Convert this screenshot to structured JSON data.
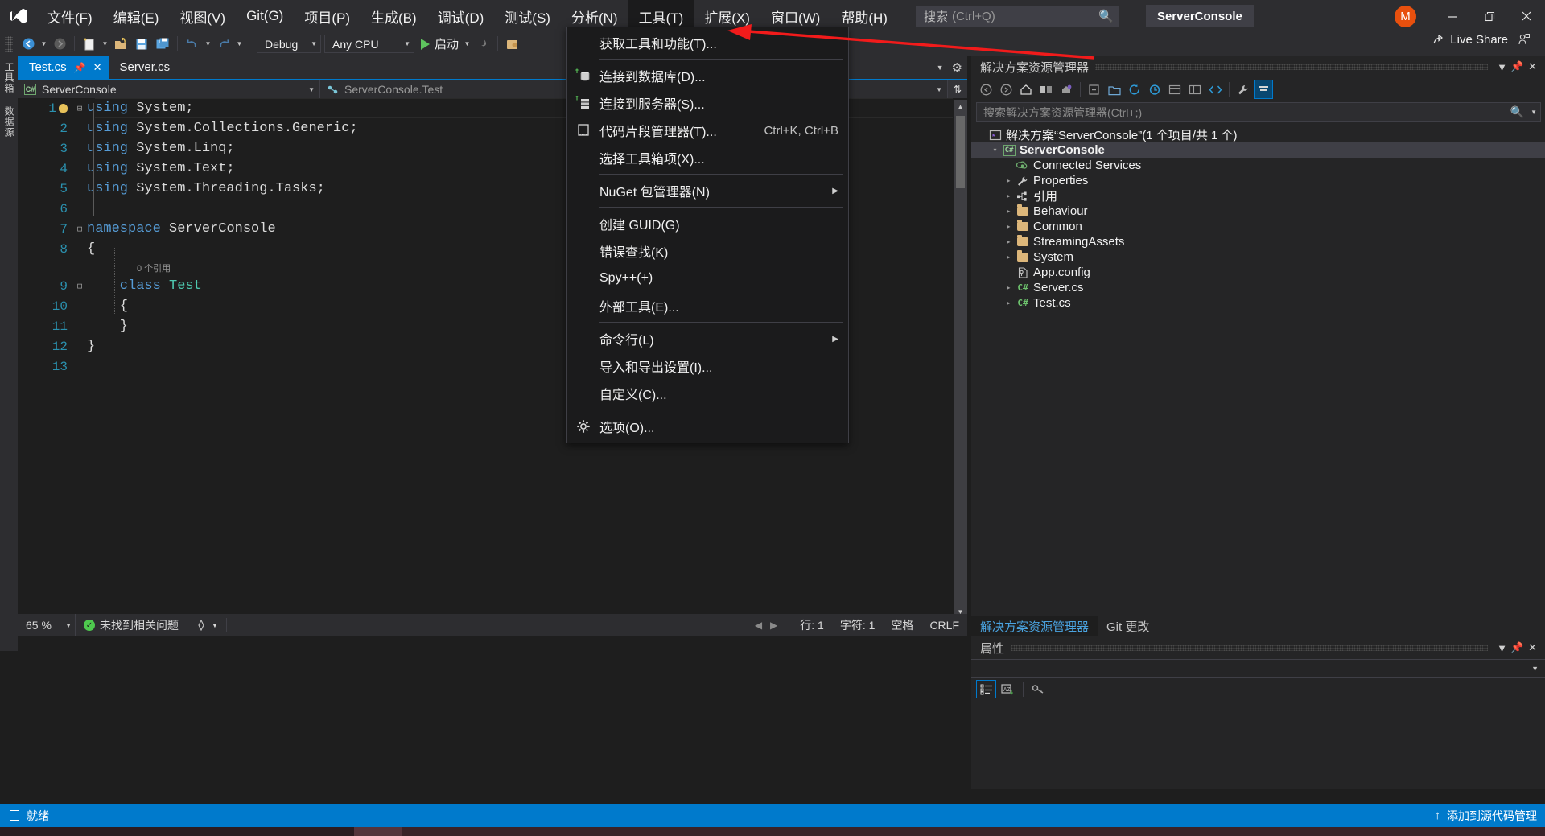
{
  "window": {
    "project_chip": "ServerConsole",
    "avatar_initial": "M",
    "live_share": "Live Share"
  },
  "menubar": {
    "items": [
      {
        "label": "文件(F)",
        "active": false
      },
      {
        "label": "编辑(E)",
        "active": false
      },
      {
        "label": "视图(V)",
        "active": false
      },
      {
        "label": "Git(G)",
        "active": false
      },
      {
        "label": "项目(P)",
        "active": false
      },
      {
        "label": "生成(B)",
        "active": false
      },
      {
        "label": "调试(D)",
        "active": false
      },
      {
        "label": "测试(S)",
        "active": false
      },
      {
        "label": "分析(N)",
        "active": false
      },
      {
        "label": "工具(T)",
        "active": true
      },
      {
        "label": "扩展(X)",
        "active": false
      },
      {
        "label": "窗口(W)",
        "active": false
      },
      {
        "label": "帮助(H)",
        "active": false
      }
    ]
  },
  "search": {
    "label": "搜索",
    "shortcut": "(Ctrl+Q)"
  },
  "toolbar": {
    "config": "Debug",
    "platform": "Any CPU",
    "run_label": "启动"
  },
  "tools_menu": {
    "items": [
      {
        "label": "获取工具和功能(T)...",
        "icon": "",
        "shortcut": "",
        "submenu": false,
        "sep_after": true
      },
      {
        "label": "连接到数据库(D)...",
        "icon": "database-icon",
        "shortcut": "",
        "submenu": false,
        "sep_after": false
      },
      {
        "label": "连接到服务器(S)...",
        "icon": "server-icon",
        "shortcut": "",
        "submenu": false,
        "sep_after": false
      },
      {
        "label": "代码片段管理器(T)...",
        "icon": "snippet-icon",
        "shortcut": "Ctrl+K, Ctrl+B",
        "submenu": false,
        "sep_after": false
      },
      {
        "label": "选择工具箱项(X)...",
        "icon": "",
        "shortcut": "",
        "submenu": false,
        "sep_after": true
      },
      {
        "label": "NuGet 包管理器(N)",
        "icon": "",
        "shortcut": "",
        "submenu": true,
        "sep_after": true
      },
      {
        "label": "创建 GUID(G)",
        "icon": "",
        "shortcut": "",
        "submenu": false,
        "sep_after": false
      },
      {
        "label": "错误查找(K)",
        "icon": "",
        "shortcut": "",
        "submenu": false,
        "sep_after": false
      },
      {
        "label": "Spy++(+)",
        "icon": "",
        "shortcut": "",
        "submenu": false,
        "sep_after": false
      },
      {
        "label": "外部工具(E)...",
        "icon": "",
        "shortcut": "",
        "submenu": false,
        "sep_after": true
      },
      {
        "label": "命令行(L)",
        "icon": "",
        "shortcut": "",
        "submenu": true,
        "sep_after": false
      },
      {
        "label": "导入和导出设置(I)...",
        "icon": "",
        "shortcut": "",
        "submenu": false,
        "sep_after": false
      },
      {
        "label": "自定义(C)...",
        "icon": "",
        "shortcut": "",
        "submenu": false,
        "sep_after": true
      },
      {
        "label": "选项(O)...",
        "icon": "gear-icon",
        "shortcut": "",
        "submenu": false,
        "sep_after": false
      }
    ]
  },
  "left_vertical_tabs": [
    {
      "label": "工具箱"
    },
    {
      "label": "数据源"
    }
  ],
  "editor": {
    "tabs": [
      {
        "label": "Test.cs",
        "active": true
      },
      {
        "label": "Server.cs",
        "active": false
      }
    ],
    "nav_left": "ServerConsole",
    "nav_right": "ServerConsole.Test",
    "cs_badge": "C#",
    "codelens": "0 个引用",
    "lines": [
      {
        "num": "1",
        "glyph": "−",
        "bulb": true,
        "segments": [
          {
            "t": "using ",
            "c": "kw"
          },
          {
            "t": "System;",
            "c": "pl"
          }
        ]
      },
      {
        "num": "2",
        "glyph": "",
        "bulb": false,
        "segments": [
          {
            "t": "using ",
            "c": "kw"
          },
          {
            "t": "System.Collections.Generic;",
            "c": "pl"
          }
        ]
      },
      {
        "num": "3",
        "glyph": "",
        "bulb": false,
        "segments": [
          {
            "t": "using ",
            "c": "kw"
          },
          {
            "t": "System.Linq;",
            "c": "pl"
          }
        ]
      },
      {
        "num": "4",
        "glyph": "",
        "bulb": false,
        "segments": [
          {
            "t": "using ",
            "c": "kw"
          },
          {
            "t": "System.Text;",
            "c": "pl"
          }
        ]
      },
      {
        "num": "5",
        "glyph": "",
        "bulb": false,
        "segments": [
          {
            "t": "using ",
            "c": "kw"
          },
          {
            "t": "System.Threading.Tasks;",
            "c": "pl"
          }
        ]
      },
      {
        "num": "6",
        "glyph": "",
        "bulb": false,
        "segments": []
      },
      {
        "num": "7",
        "glyph": "−",
        "bulb": false,
        "segments": [
          {
            "t": "namespace ",
            "c": "kw"
          },
          {
            "t": "ServerConsole",
            "c": "ns"
          }
        ]
      },
      {
        "num": "8",
        "glyph": "",
        "bulb": false,
        "segments": [
          {
            "t": "{",
            "c": "pl"
          }
        ]
      },
      {
        "num": "9",
        "glyph": "−",
        "bulb": false,
        "segments": [
          {
            "t": "    class ",
            "c": "kw"
          },
          {
            "t": "Test",
            "c": "ty"
          }
        ]
      },
      {
        "num": "10",
        "glyph": "",
        "bulb": false,
        "segments": [
          {
            "t": "    {",
            "c": "pl"
          }
        ]
      },
      {
        "num": "11",
        "glyph": "",
        "bulb": false,
        "segments": [
          {
            "t": "    }",
            "c": "pl"
          }
        ]
      },
      {
        "num": "12",
        "glyph": "",
        "bulb": false,
        "segments": [
          {
            "t": "}",
            "c": "pl"
          }
        ]
      },
      {
        "num": "13",
        "glyph": "",
        "bulb": false,
        "segments": []
      }
    ],
    "status": {
      "zoom": "65 %",
      "problems": "未找到相关问题",
      "line": "行: 1",
      "col": "字符: 1",
      "space": "空格",
      "eol": "CRLF"
    }
  },
  "solution_explorer": {
    "title": "解决方案资源管理器",
    "search_placeholder": "搜索解决方案资源管理器(Ctrl+;)",
    "tree": [
      {
        "label": "解决方案“ServerConsole”(1 个项目/共 1 个)",
        "depth": 0,
        "twisty": "",
        "icon": "solution-icon",
        "selected": false,
        "bold": false
      },
      {
        "label": "ServerConsole",
        "depth": 1,
        "twisty": "▾",
        "icon": "csproj-icon",
        "selected": true,
        "bold": true
      },
      {
        "label": "Connected Services",
        "depth": 2,
        "twisty": "",
        "icon": "connected-icon",
        "selected": false,
        "bold": false
      },
      {
        "label": "Properties",
        "depth": 2,
        "twisty": "▸",
        "icon": "wrench-icon",
        "selected": false,
        "bold": false
      },
      {
        "label": "引用",
        "depth": 2,
        "twisty": "▸",
        "icon": "references-icon",
        "selected": false,
        "bold": false
      },
      {
        "label": "Behaviour",
        "depth": 2,
        "twisty": "▸",
        "icon": "folder-icon",
        "selected": false,
        "bold": false
      },
      {
        "label": "Common",
        "depth": 2,
        "twisty": "▸",
        "icon": "folder-icon",
        "selected": false,
        "bold": false
      },
      {
        "label": "StreamingAssets",
        "depth": 2,
        "twisty": "▸",
        "icon": "folder-icon",
        "selected": false,
        "bold": false
      },
      {
        "label": "System",
        "depth": 2,
        "twisty": "▸",
        "icon": "folder-icon",
        "selected": false,
        "bold": false
      },
      {
        "label": "App.config",
        "depth": 2,
        "twisty": "",
        "icon": "config-icon",
        "selected": false,
        "bold": false
      },
      {
        "label": "Server.cs",
        "depth": 2,
        "twisty": "▸",
        "icon": "cs-file-icon",
        "selected": false,
        "bold": false
      },
      {
        "label": "Test.cs",
        "depth": 2,
        "twisty": "▸",
        "icon": "cs-file-icon",
        "selected": false,
        "bold": false
      }
    ],
    "bottom_tabs": [
      {
        "label": "解决方案资源管理器",
        "active": true
      },
      {
        "label": "Git 更改",
        "active": false
      }
    ]
  },
  "properties_panel": {
    "title": "属性"
  },
  "statusbar": {
    "ready": "就绪",
    "source_control": "添加到源代码管理"
  }
}
